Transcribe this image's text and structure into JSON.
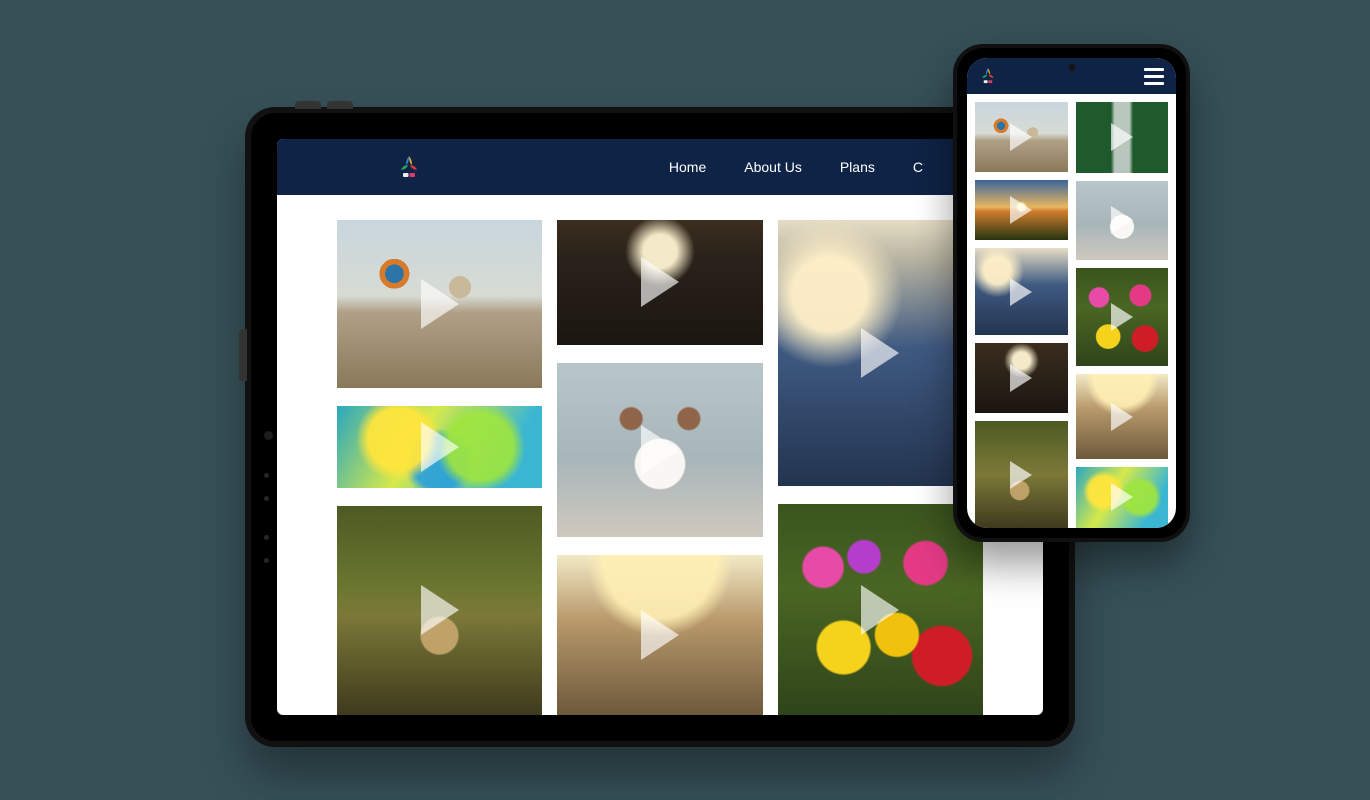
{
  "colors": {
    "page_bg": "#365057",
    "navbar_bg": "#0f2346",
    "nav_text": "#ffffff",
    "play_overlay": "rgba(255,255,255,0.65)"
  },
  "tablet": {
    "nav": {
      "items": [
        {
          "label": "Home"
        },
        {
          "label": "About Us"
        },
        {
          "label": "Plans"
        },
        {
          "label": "C"
        }
      ]
    },
    "gallery": {
      "columns": [
        [
          {
            "name": "hot-air-balloons"
          },
          {
            "name": "color-festival"
          },
          {
            "name": "deer"
          }
        ],
        [
          {
            "name": "concert-crowd"
          },
          {
            "name": "dog"
          },
          {
            "name": "friends-group"
          }
        ],
        [
          {
            "name": "hands-raised-sunlight"
          },
          {
            "name": "tulips"
          }
        ]
      ]
    }
  },
  "phone": {
    "gallery": {
      "columns": [
        [
          {
            "name": "hot-air-balloons"
          },
          {
            "name": "sunset-field"
          },
          {
            "name": "hands-raised-sunlight"
          },
          {
            "name": "concert-crowd"
          },
          {
            "name": "deer"
          }
        ],
        [
          {
            "name": "waterfall"
          },
          {
            "name": "dog"
          },
          {
            "name": "tulips"
          },
          {
            "name": "friends-group"
          },
          {
            "name": "color-festival"
          }
        ]
      ]
    }
  },
  "icons": {
    "logo": "colorful-leaf-logo",
    "play": "play-icon",
    "hamburger": "hamburger-menu-icon"
  }
}
